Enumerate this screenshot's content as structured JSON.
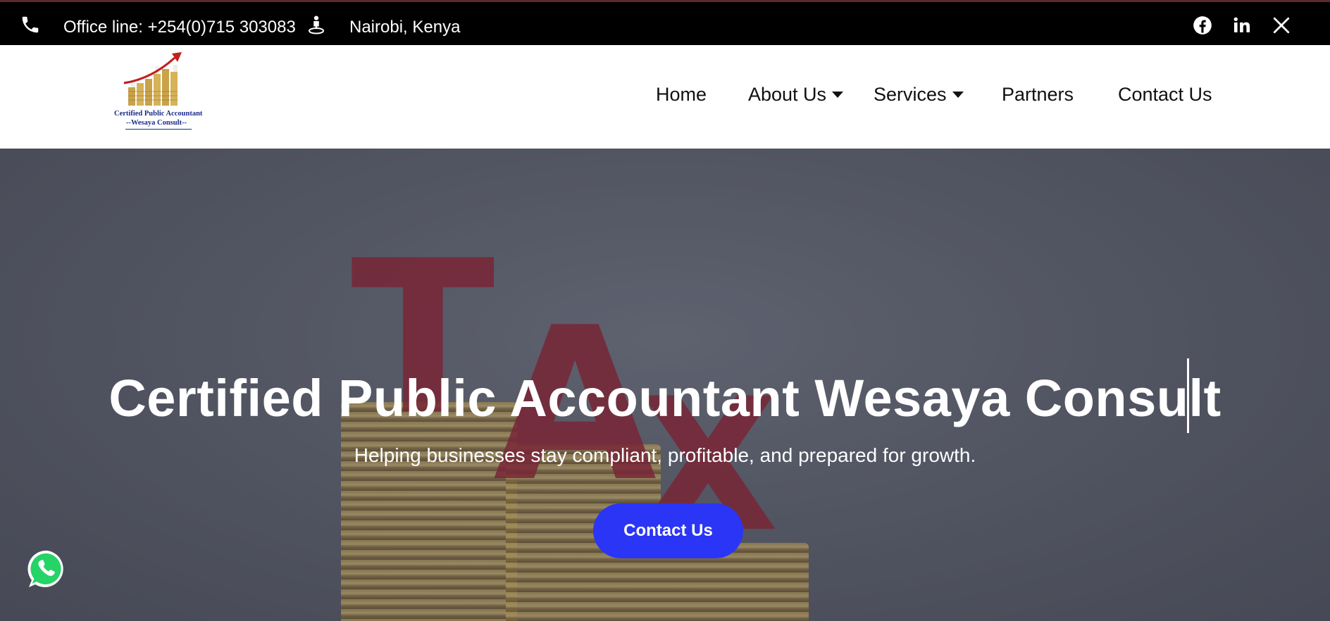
{
  "topbar": {
    "phone_icon": "phone-icon",
    "phone_text": "Office line: +254(0)715 303083",
    "location_icon": "location-person-icon",
    "location_text": "Nairobi, Kenya",
    "socials": [
      "facebook-icon",
      "linkedin-icon",
      "x-icon"
    ]
  },
  "logo": {
    "line1": "Certified Public Accountant",
    "line2": "--Wesaya Consult--"
  },
  "nav": {
    "items": [
      {
        "label": "Home",
        "has_dropdown": false
      },
      {
        "label": "About Us",
        "has_dropdown": true
      },
      {
        "label": "Services",
        "has_dropdown": true
      },
      {
        "label": "Partners",
        "has_dropdown": false
      },
      {
        "label": "Contact Us",
        "has_dropdown": false
      }
    ]
  },
  "hero": {
    "title": "Certified Public Accountant Wesaya Consult",
    "subtitle": "Helping businesses stay compliant, profitable, and prepared for growth.",
    "cta_label": "Contact Us",
    "background_letters": [
      "T",
      "A",
      "X"
    ]
  },
  "colors": {
    "topbar_bg": "#000000",
    "cta_bg": "#2b35f5",
    "whatsapp": "#25d366",
    "logo_text": "#1b2a8a"
  },
  "floating": {
    "whatsapp_icon": "whatsapp-icon"
  }
}
